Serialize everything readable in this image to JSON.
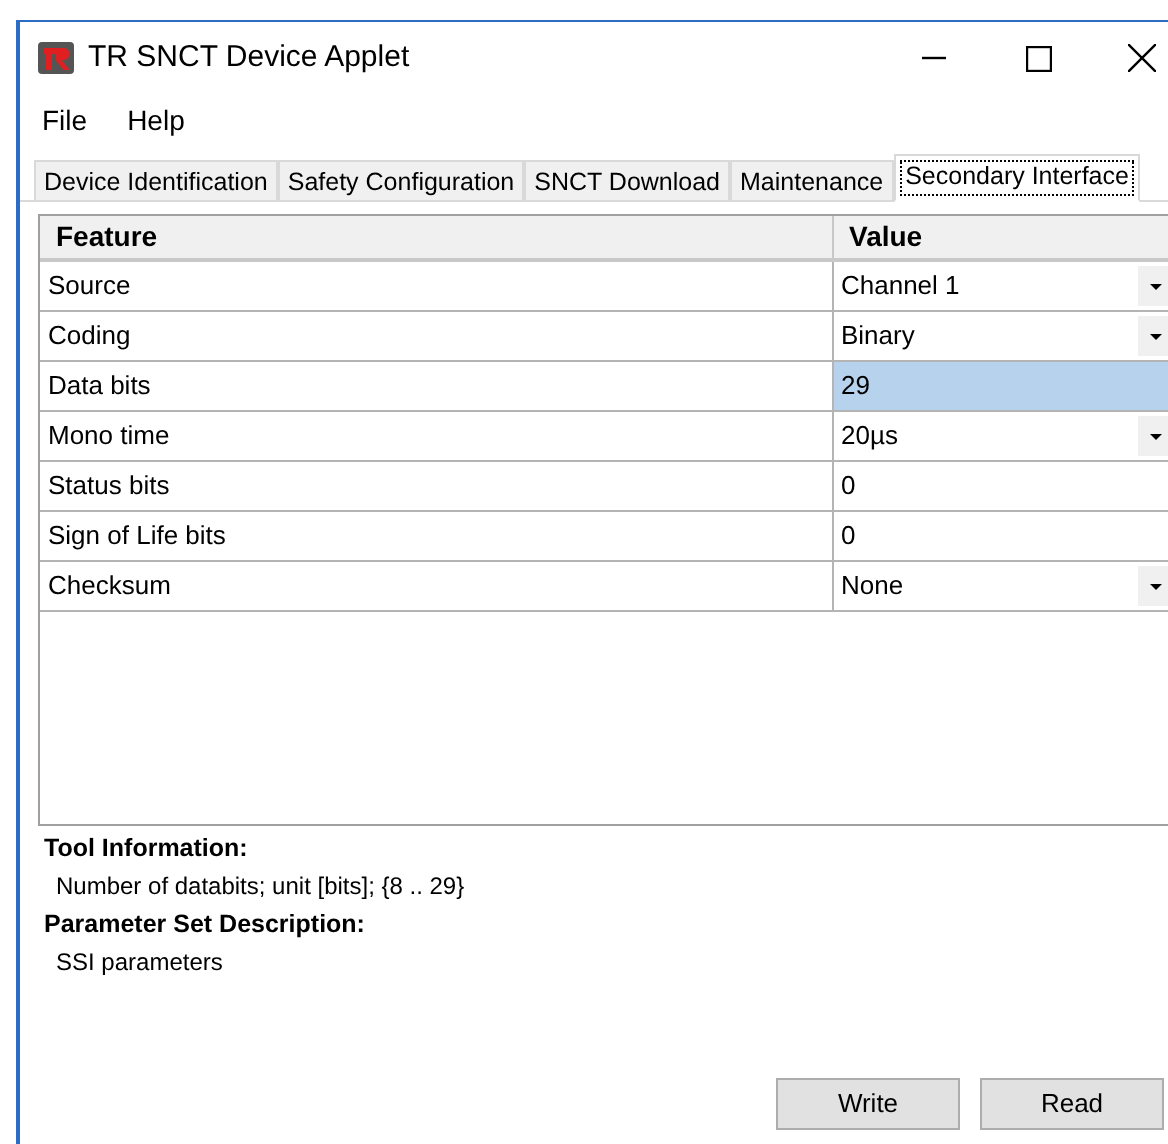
{
  "window": {
    "title": "TR SNCT Device Applet"
  },
  "menu": [
    "File",
    "Help"
  ],
  "tabs": [
    {
      "label": "Device Identification",
      "selected": false
    },
    {
      "label": "Safety Configuration",
      "selected": false
    },
    {
      "label": "SNCT Download",
      "selected": false
    },
    {
      "label": "Maintenance",
      "selected": false
    },
    {
      "label": "Secondary Interface",
      "selected": true
    }
  ],
  "table": {
    "columns": [
      "Feature",
      "Value"
    ],
    "rows": [
      {
        "feature": "Source",
        "value": "Channel 1",
        "kind": "dropdown",
        "selected": false
      },
      {
        "feature": "Coding",
        "value": "Binary",
        "kind": "dropdown",
        "selected": false
      },
      {
        "feature": "Data bits",
        "value": "29",
        "kind": "text",
        "selected": true
      },
      {
        "feature": "Mono time",
        "value": "20µs",
        "kind": "dropdown",
        "selected": false
      },
      {
        "feature": "Status bits",
        "value": "0",
        "kind": "text",
        "selected": false
      },
      {
        "feature": "Sign of Life bits",
        "value": "0",
        "kind": "text",
        "selected": false
      },
      {
        "feature": "Checksum",
        "value": "None",
        "kind": "dropdown",
        "selected": false
      }
    ]
  },
  "tool_information": {
    "heading": "Tool Information:",
    "text": "Number of databits; unit [bits]; {8 .. 29}"
  },
  "parameter_set_description": {
    "heading": "Parameter Set Description:",
    "text": "SSI parameters"
  },
  "buttons": [
    "Write",
    "Read"
  ]
}
